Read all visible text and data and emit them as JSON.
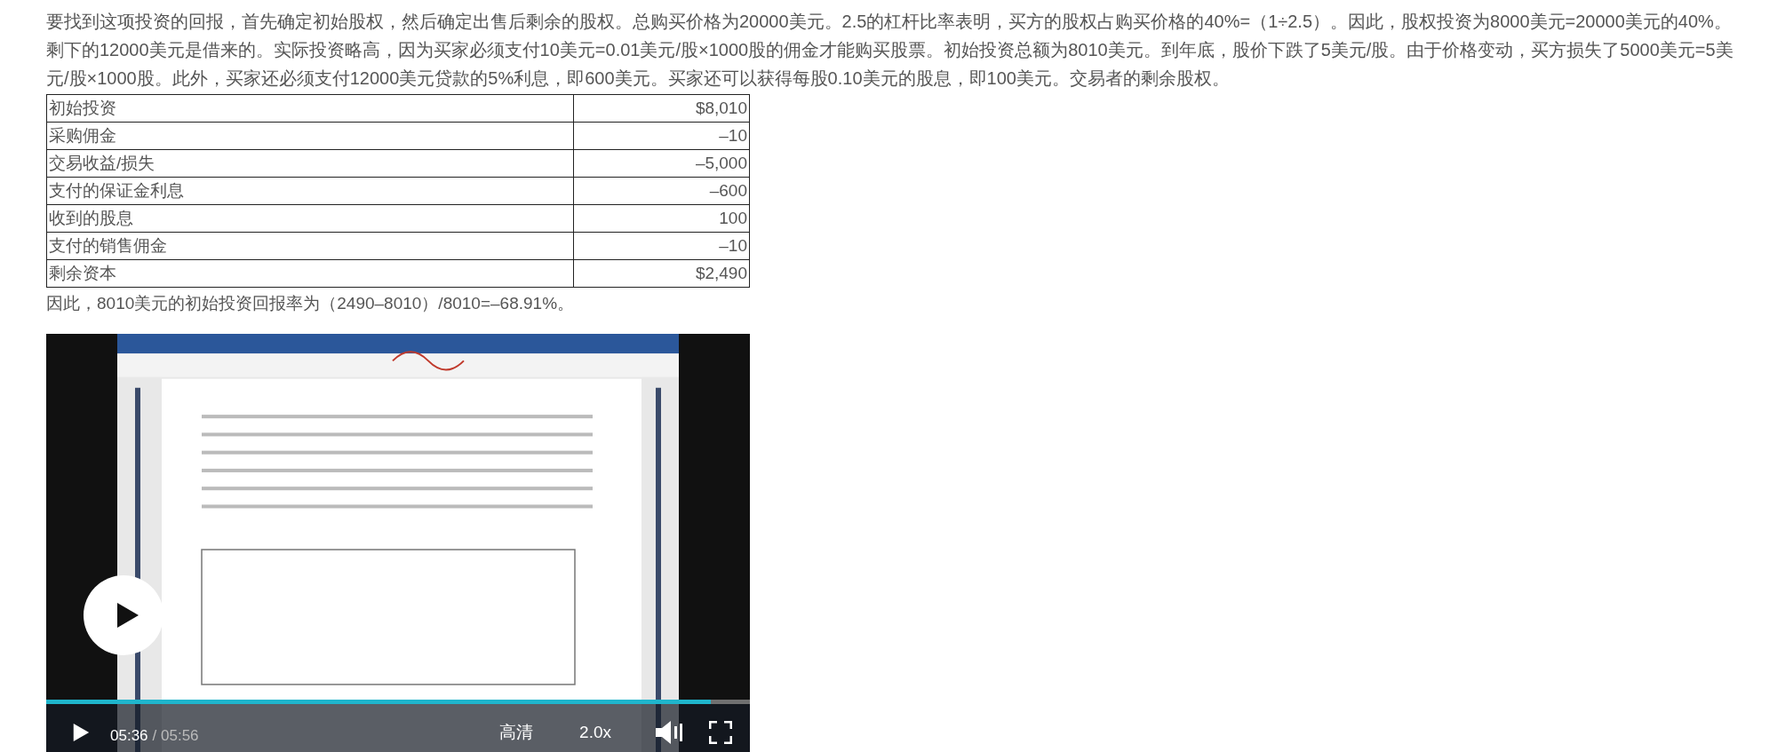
{
  "intro": "要找到这项投资的回报，首先确定初始股权，然后确定出售后剩余的股权。总购买价格为20000美元。2.5的杠杆比率表明，买方的股权占购买价格的40%=（1÷2.5）。因此，股权投资为8000美元=20000美元的40%。剩下的12000美元是借来的。实际投资略高，因为买家必须支付10美元=0.01美元/股×1000股的佣金才能购买股票。初始投资总额为8010美元。到年底，股价下跌了5美元/股。由于价格变动，买方损失了5000美元=5美元/股×1000股。此外，买家还必须支付12000美元贷款的5%利息，即600美元。买家还可以获得每股0.10美元的股息，即100美元。交易者的剩余股权。",
  "table": {
    "rows": [
      {
        "label": "初始投资",
        "value": "$8,010"
      },
      {
        "label": "采购佣金",
        "value": "–10"
      },
      {
        "label": "交易收益/损失",
        "value": "–5,000"
      },
      {
        "label": "支付的保证金利息",
        "value": "–600"
      },
      {
        "label": "收到的股息",
        "value": "100"
      },
      {
        "label": "支付的销售佣金",
        "value": "–10"
      },
      {
        "label": "剩余资本",
        "value": "$2,490"
      }
    ]
  },
  "conclusion": "因此，8010美元的初始投资回报率为（2490–8010）/8010=–68.91%。",
  "video": {
    "kind": "picture",
    "progress": {
      "level": 0.944
    },
    "current_time": "05:36",
    "total_time": "/ 05:56",
    "quality": "高清",
    "speed": "2.0x"
  }
}
